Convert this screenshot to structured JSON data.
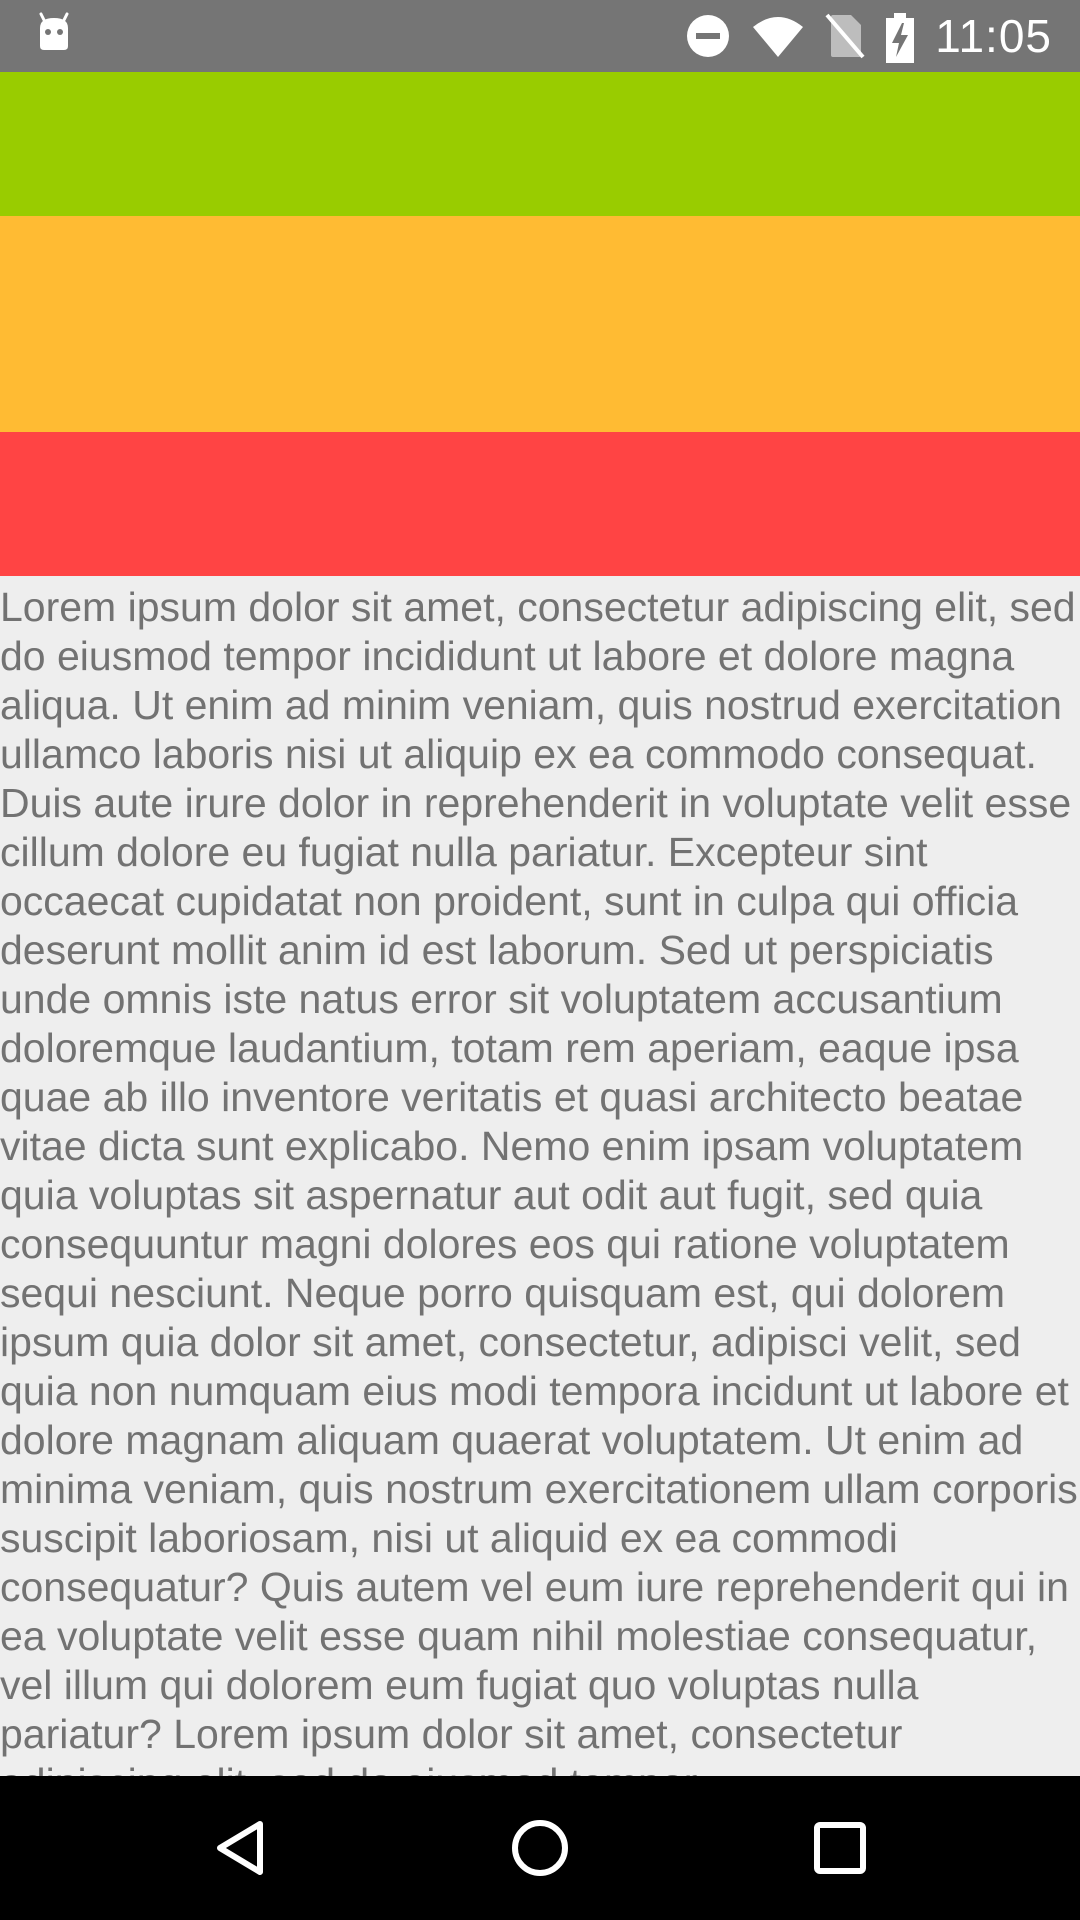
{
  "status_bar": {
    "time": "11:05",
    "icons": [
      "android-debug-icon",
      "do-not-disturb-icon",
      "wifi-icon",
      "no-sim-icon",
      "battery-charging-icon"
    ],
    "background": "#757575"
  },
  "bands": {
    "green": "#99cc00",
    "orange": "#ffbb33",
    "red": "#ff4444"
  },
  "content": {
    "text": "Lorem ipsum dolor sit amet, consectetur adipiscing elit, sed do eiusmod tempor incididunt ut labore et dolore magna aliqua. Ut enim ad minim veniam, quis nostrud exercitation ullamco laboris nisi ut aliquip ex ea commodo consequat. Duis aute irure dolor in reprehenderit in voluptate velit esse cillum dolore eu fugiat nulla pariatur. Excepteur sint occaecat cupidatat non proident, sunt in culpa qui officia deserunt mollit anim id est laborum. Sed ut perspiciatis unde omnis iste natus error sit voluptatem accusantium doloremque laudantium, totam rem aperiam, eaque ipsa quae ab illo inventore veritatis et quasi architecto beatae vitae dicta sunt explicabo. Nemo enim ipsam voluptatem quia voluptas sit aspernatur aut odit aut fugit, sed quia consequuntur magni dolores eos qui ratione voluptatem sequi nesciunt. Neque porro quisquam est, qui dolorem ipsum quia dolor sit amet, consectetur, adipisci velit, sed quia non numquam eius modi tempora incidunt ut labore et dolore magnam aliquam quaerat voluptatem. Ut enim ad minima veniam, quis nostrum exercitationem ullam corporis suscipit laboriosam, nisi ut aliquid ex ea commodi consequatur? Quis autem vel eum iure reprehenderit qui in ea voluptate velit esse quam nihil molestiae consequatur, vel illum qui dolorem eum fugiat quo voluptas nulla pariatur? Lorem ipsum dolor sit amet, consectetur adipiscing elit, sed do eiusmod tempor"
  },
  "nav_bar": {
    "buttons": [
      "back-icon",
      "home-icon",
      "recents-icon"
    ]
  }
}
